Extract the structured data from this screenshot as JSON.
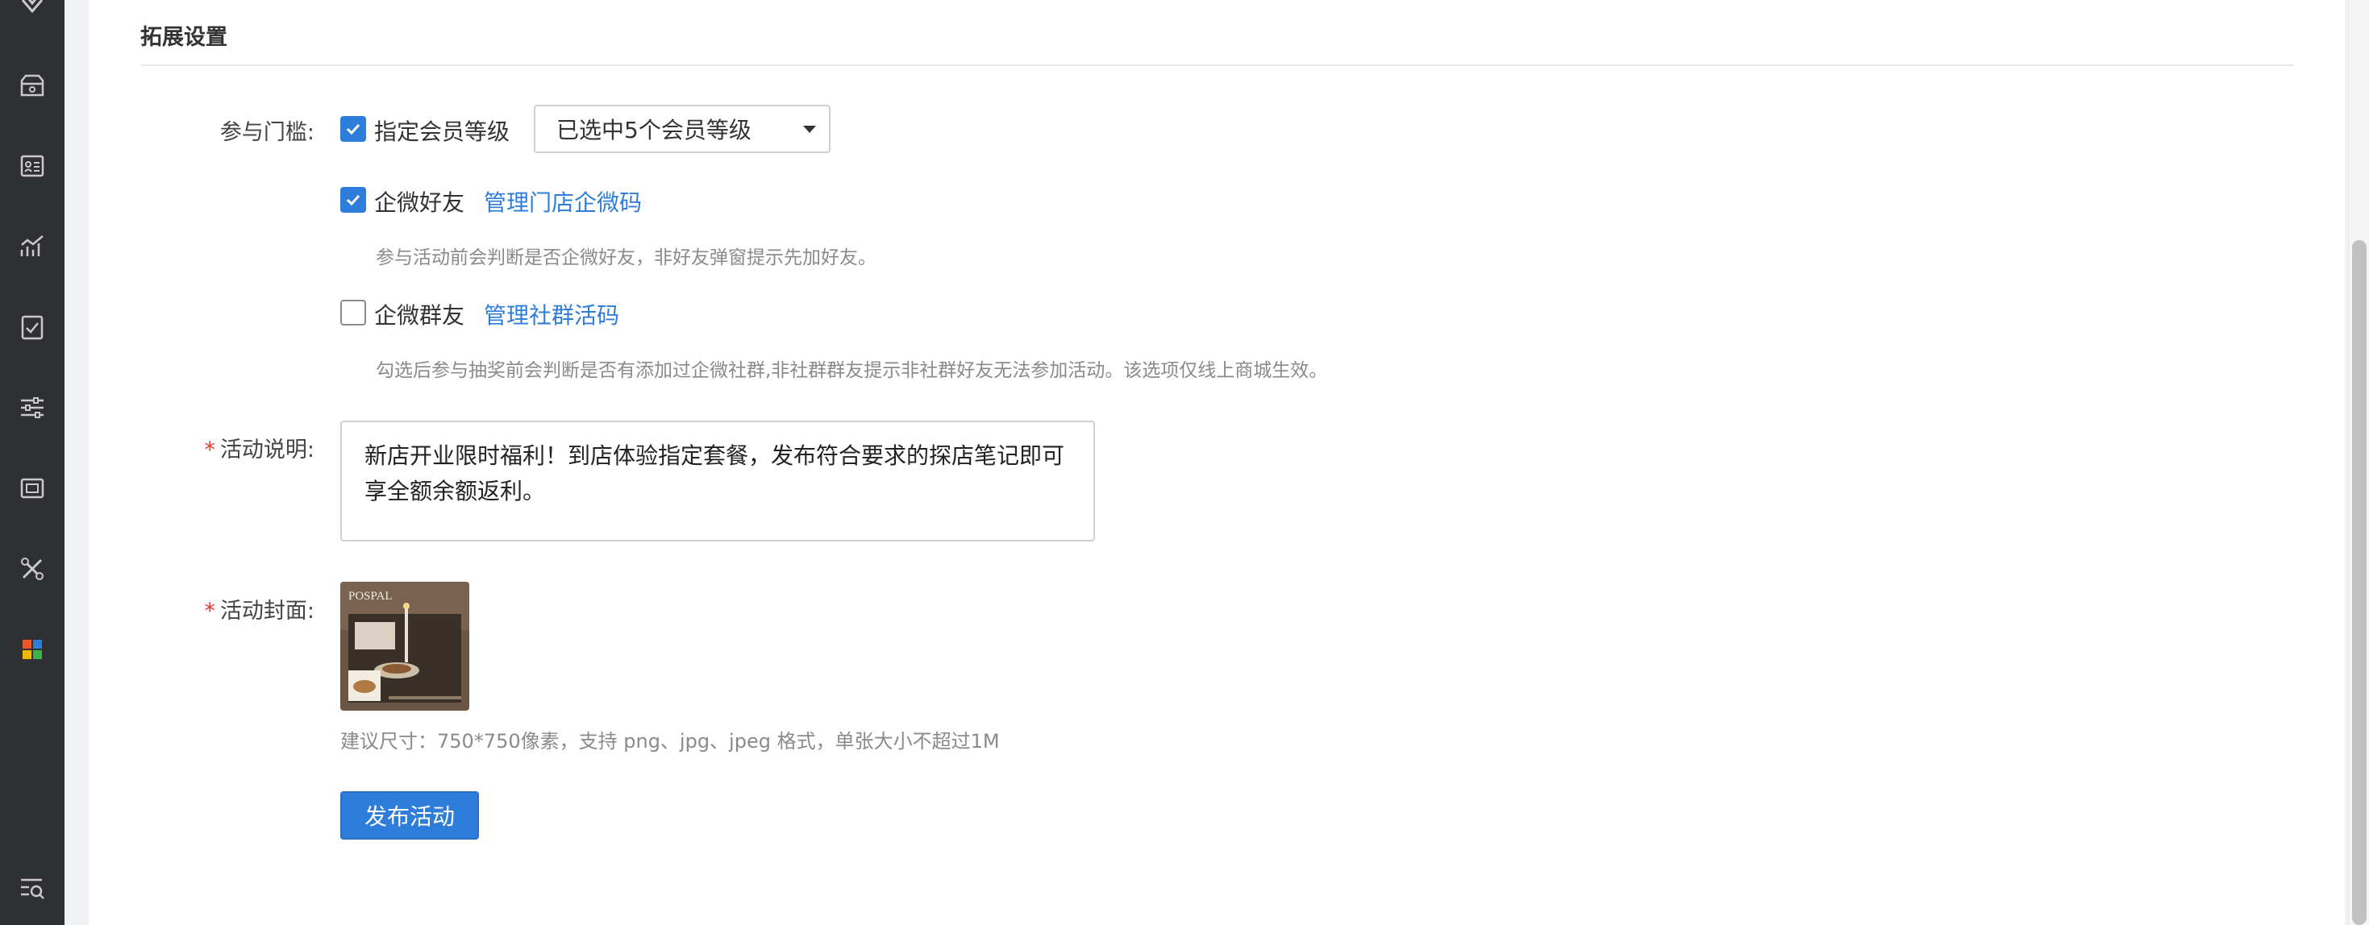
{
  "section": {
    "title": "拓展设置"
  },
  "threshold": {
    "label": "参与门槛:",
    "member_level": {
      "checked": true,
      "label": "指定会员等级",
      "select_value": "已选中5个会员等级"
    },
    "wecom_friend": {
      "checked": true,
      "label": "企微好友",
      "link": "管理门店企微码",
      "hint": "参与活动前会判断是否企微好友，非好友弹窗提示先加好友。"
    },
    "wecom_group": {
      "checked": false,
      "label": "企微群友",
      "link": "管理社群活码",
      "hint": "勾选后参与抽奖前会判断是否有添加过企微社群,非社群群友提示非社群好友无法参加活动。该选项仅线上商城生效。"
    }
  },
  "description": {
    "required_mark": "*",
    "label": "活动说明:",
    "value": "新店开业限时福利！到店体验指定套餐，发布符合要求的探店笔记即可享全额余额返利。"
  },
  "cover": {
    "required_mark": "*",
    "label": "活动封面:",
    "image_text": "POSPAL",
    "hint": "建议尺寸：750*750像素，支持 png、jpg、jpeg 格式，单张大小不超过1M"
  },
  "actions": {
    "publish_label": "发布活动"
  },
  "colors": {
    "primary": "#2f7ddb",
    "sidebar": "#2f3033",
    "required": "#e53935"
  },
  "sidebar_icons": [
    "diamond-icon",
    "ticket-icon",
    "id-card-icon",
    "chart-icon",
    "checklist-icon",
    "sliders-icon",
    "coupon-icon",
    "tools-icon",
    "apps-icon",
    "search-list-icon"
  ]
}
